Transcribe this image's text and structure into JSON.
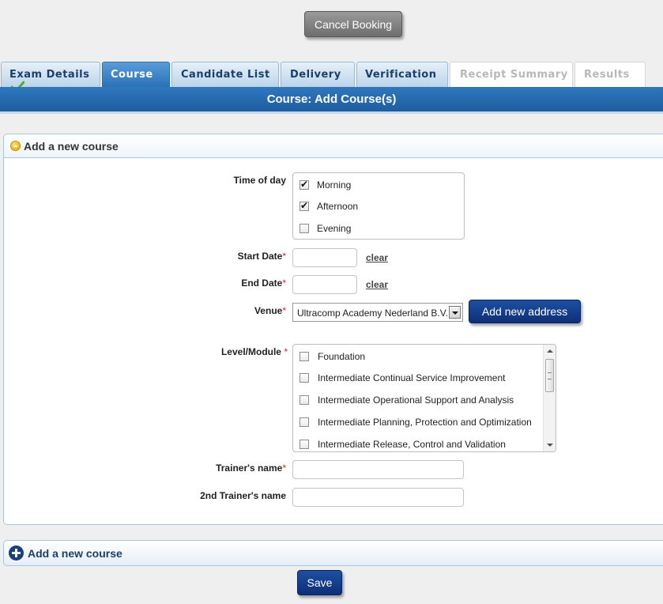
{
  "actions": {
    "cancel_label": "Cancel Booking",
    "save_label": "Save"
  },
  "tabs": [
    {
      "label": "Exam Details",
      "state": "completed"
    },
    {
      "label": "Course",
      "state": "active"
    },
    {
      "label": "Candidate List",
      "state": "normal"
    },
    {
      "label": "Delivery",
      "state": "normal"
    },
    {
      "label": "Verification",
      "state": "normal"
    },
    {
      "label": "Receipt Summary",
      "state": "disabled"
    },
    {
      "label": "Results",
      "state": "disabled"
    }
  ],
  "header": {
    "title": "Course: Add Course(s)"
  },
  "panel": {
    "title": "Add a new course"
  },
  "form": {
    "time_of_day": {
      "label": "Time of day",
      "options": [
        {
          "label": "Morning",
          "checked": true
        },
        {
          "label": "Afternoon",
          "checked": true
        },
        {
          "label": "Evening",
          "checked": false
        }
      ]
    },
    "start_date": {
      "label": "Start Date",
      "value": "",
      "clear_label": "clear"
    },
    "end_date": {
      "label": "End Date",
      "value": "",
      "clear_label": "clear"
    },
    "venue": {
      "label": "Venue",
      "selected": "Ultracomp Academy Nederland B.V.",
      "add_button_label": "Add new address"
    },
    "level_module": {
      "label": "Level/Module",
      "options": [
        {
          "label": "Foundation",
          "checked": false
        },
        {
          "label": "Intermediate Continual Service Improvement",
          "checked": false
        },
        {
          "label": "Intermediate Operational Support and Analysis",
          "checked": false
        },
        {
          "label": "Intermediate Planning, Protection and Optimization",
          "checked": false
        },
        {
          "label": "Intermediate Release, Control and Validation",
          "checked": false
        }
      ]
    },
    "trainer_name": {
      "label": "Trainer's name",
      "value": ""
    },
    "second_trainer_name": {
      "label": "2nd Trainer's name",
      "value": ""
    },
    "required_marker": "*"
  },
  "collapsed_panel": {
    "title": "Add a new course"
  },
  "colors": {
    "accent_blue": "#1e5da0",
    "button_navy": "#0e2f78",
    "check_green": "#4caf2a"
  }
}
